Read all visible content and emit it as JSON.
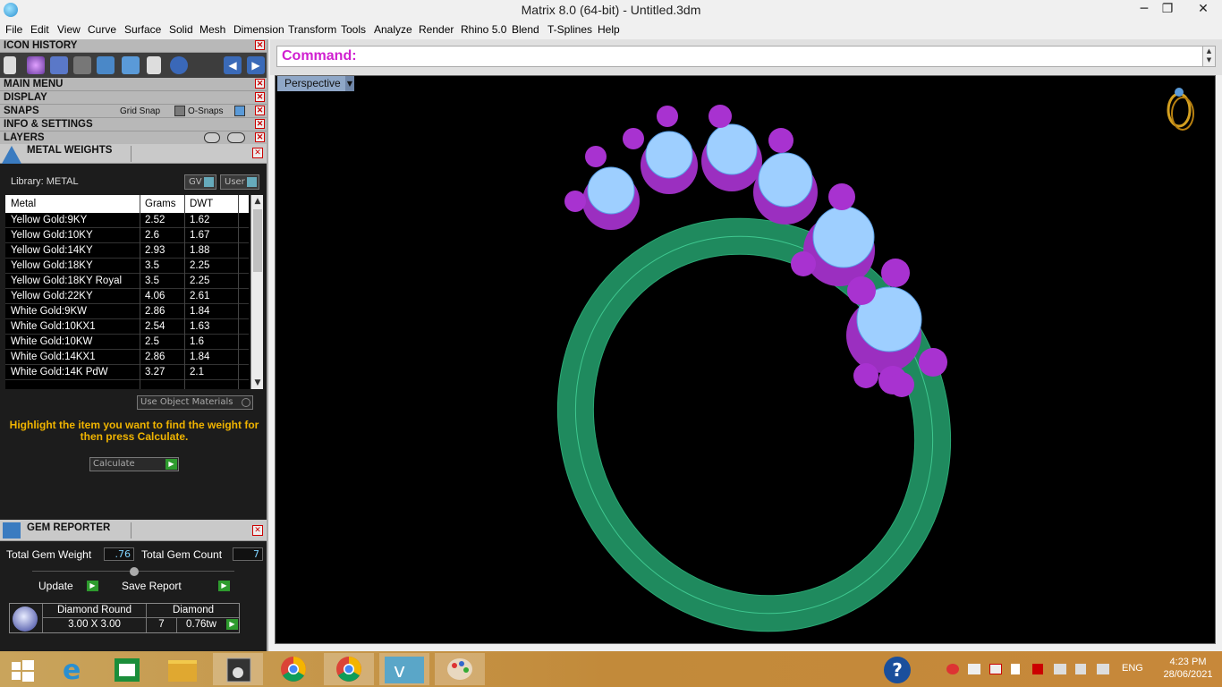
{
  "window": {
    "title": "Matrix 8.0 (64-bit) - Untitled.3dm",
    "min_glyph": "─",
    "max_glyph": "❐",
    "close_glyph": "✕"
  },
  "menu": [
    "File",
    "Edit",
    "View",
    "Curve",
    "Surface",
    "Solid",
    "Mesh",
    "Dimension",
    "Transform",
    "Tools",
    "Analyze",
    "Render",
    "Rhino 5.0",
    "Blend",
    "T-Splines",
    "Help"
  ],
  "left_panel": {
    "icon_history": "ICON HISTORY",
    "main_menu": "MAIN MENU",
    "display": "DISPLAY",
    "snaps": "SNAPS",
    "grid_snap": "Grid Snap",
    "o_snaps": "O-Snaps",
    "info_settings": "INFO & SETTINGS",
    "layers": "LAYERS"
  },
  "metal_weights": {
    "title": "METAL WEIGHTS",
    "library": "Library: METAL",
    "gv": "GV",
    "user": "User",
    "columns": [
      "Metal",
      "Grams",
      "DWT"
    ],
    "rows": [
      [
        "Yellow Gold:9KY",
        "2.52",
        "1.62"
      ],
      [
        "Yellow Gold:10KY",
        "2.6",
        "1.67"
      ],
      [
        "Yellow Gold:14KY",
        "2.93",
        "1.88"
      ],
      [
        "Yellow Gold:18KY",
        "3.5",
        "2.25"
      ],
      [
        "Yellow Gold:18KY Royal",
        "3.5",
        "2.25"
      ],
      [
        "Yellow Gold:22KY",
        "4.06",
        "2.61"
      ],
      [
        "White Gold:9KW",
        "2.86",
        "1.84"
      ],
      [
        "White Gold:10KX1",
        "2.54",
        "1.63"
      ],
      [
        "White Gold:10KW",
        "2.5",
        "1.6"
      ],
      [
        "White Gold:14KX1",
        "2.86",
        "1.84"
      ],
      [
        "White Gold:14K PdW",
        "3.27",
        "2.1"
      ]
    ],
    "use_object_materials": "Use Object Materials",
    "hint": "Highlight the item you want to find the weight for then press Calculate.",
    "calculate": "Calculate"
  },
  "gem_reporter": {
    "title": "GEM REPORTER",
    "total_weight_label": "Total Gem Weight",
    "total_weight": ".76",
    "total_count_label": "Total Gem Count",
    "total_count": "7",
    "update": "Update",
    "save_report": "Save Report",
    "gem": {
      "shape": "Diamond Round",
      "material": "Diamond",
      "size": "3.00 X 3.00",
      "count": "7",
      "weight": "0.76tw"
    }
  },
  "command": {
    "label": "Command:",
    "value": ""
  },
  "viewport": {
    "name": "Perspective",
    "colors": {
      "shank": "#1f8a5e",
      "prongs": "#9b2fc0",
      "stones": "#9ecfff",
      "background": "#000000"
    }
  },
  "taskbar": {
    "lang": "ENG",
    "time": "4:23 PM",
    "date": "28/06/2021"
  }
}
